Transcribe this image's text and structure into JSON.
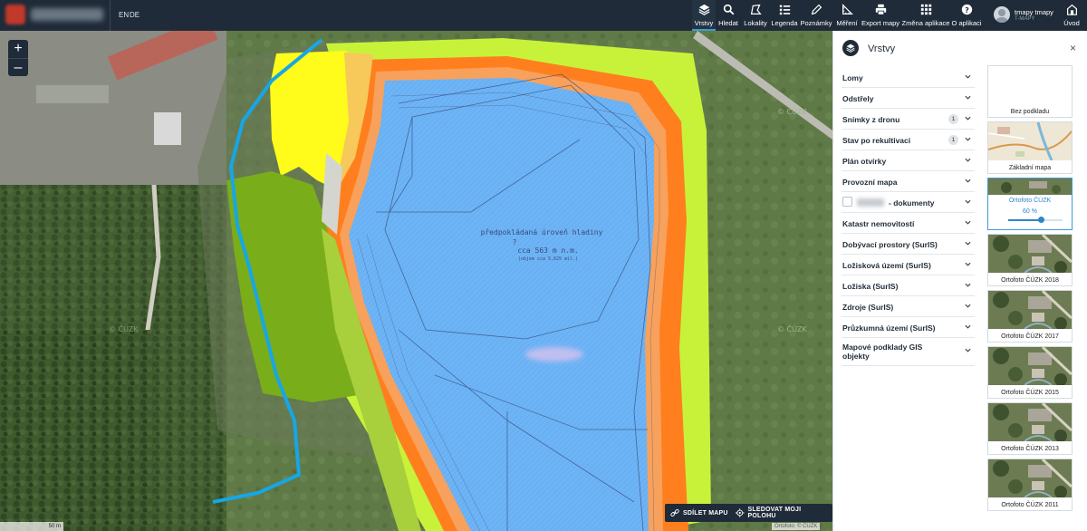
{
  "toolbar": {
    "langs": [
      "EN",
      "DE"
    ],
    "items": [
      {
        "label": "Vrstvy",
        "icon": "layers-icon",
        "active": true
      },
      {
        "label": "Hledat",
        "icon": "search-icon"
      },
      {
        "label": "Lokality",
        "icon": "polygon-icon"
      },
      {
        "label": "Legenda",
        "icon": "legend-icon"
      },
      {
        "label": "Poznámky",
        "icon": "pencil-icon"
      },
      {
        "label": "Měření",
        "icon": "ruler-icon"
      },
      {
        "label": "Export mapy",
        "icon": "printer-icon"
      },
      {
        "label": "Změna aplikace",
        "icon": "app-grid-icon"
      },
      {
        "label": "O aplikaci",
        "icon": "help-icon"
      }
    ],
    "user_name": "tmapy tmapy",
    "user_role": "T-MAPY",
    "home_label": "Úvod"
  },
  "map": {
    "zoom_in": "+",
    "zoom_out": "–",
    "share_label": "SDÍLET MAPU",
    "follow_label": "SLEDOVAT MOJI POLOHU",
    "scale": "50 m",
    "attribution": "Ortofoto: © ČÚZK",
    "watermark": "© ČÚZK",
    "annotation_line1": "předpokládaná úroveň hladiny",
    "annotation_line2": "?",
    "annotation_line3": "cca 563 m n.m.",
    "annotation_line4": "(objem cca 5,625 mil.)"
  },
  "panel": {
    "title": "Vrstvy",
    "close": "×",
    "layers": [
      {
        "label": "Lomy"
      },
      {
        "label": "Odstřely"
      },
      {
        "label": "Snímky z dronu",
        "badge": "1"
      },
      {
        "label": "Stav po rekultivaci",
        "badge": "1"
      },
      {
        "label": "Plán otvírky"
      },
      {
        "label": "Provozní mapa"
      },
      {
        "label": "- dokumenty",
        "checkbox": true
      },
      {
        "label": "Katastr nemovitostí"
      },
      {
        "label": "Dobývací prostory (SurIS)"
      },
      {
        "label": "Ložisková území (SurIS)"
      },
      {
        "label": "Ložiska (SurIS)"
      },
      {
        "label": "Zdroje (SurIS)"
      },
      {
        "label": "Průzkumná území (SurIS)"
      },
      {
        "label": "Mapové podklady GIS objekty"
      }
    ],
    "basemaps": [
      {
        "label": "Bez podkladu",
        "type": "blank"
      },
      {
        "label": "Základní mapa",
        "type": "street"
      },
      {
        "label": "Ortofoto ČÚZK",
        "type": "ortho",
        "active": true,
        "opacity_label": "60 %",
        "opacity": 0.6
      },
      {
        "label": "Ortofoto ČÚZK 2018",
        "type": "ortho"
      },
      {
        "label": "Ortofoto ČÚZK 2017",
        "type": "ortho"
      },
      {
        "label": "Ortofoto ČÚZK 2015",
        "type": "ortho"
      },
      {
        "label": "Ortofoto ČÚZK 2013",
        "type": "ortho"
      },
      {
        "label": "Ortofoto ČÚZK 2011",
        "type": "ortho"
      }
    ]
  }
}
